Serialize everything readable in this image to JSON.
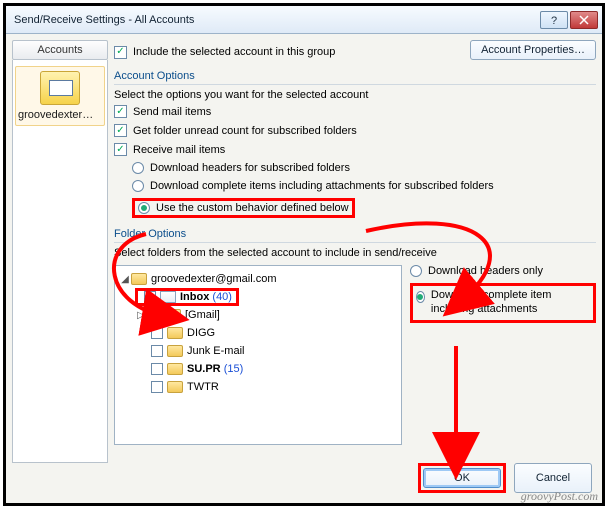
{
  "window": {
    "title": "Send/Receive Settings - All Accounts"
  },
  "left": {
    "header": "Accounts",
    "account_label": "groovedexter@…"
  },
  "top": {
    "include_label": "Include the selected account in this group",
    "account_properties_btn": "Account Properties…"
  },
  "account_options": {
    "heading": "Account Options",
    "intro": "Select the options you want for the selected account",
    "send_mail": "Send mail items",
    "get_unread": "Get folder unread count for subscribed folders",
    "receive_mail": "Receive mail items",
    "r_headers": "Download headers for subscribed folders",
    "r_complete": "Download complete items including attachments for subscribed folders",
    "r_custom": "Use the custom behavior defined below"
  },
  "folder_options": {
    "heading": "Folder Options",
    "intro": "Select folders from the selected account to include in send/receive",
    "right_headers": "Download headers only",
    "right_complete": "Download complete item including attachments",
    "tree": {
      "root": "groovedexter@gmail.com",
      "inbox_label": "Inbox",
      "inbox_count": "(40)",
      "gmail": "[Gmail]",
      "digg": "DIGG",
      "junk": "Junk E-mail",
      "supr_label": "SU.PR",
      "supr_count": "(15)",
      "twtr": "TWTR"
    }
  },
  "buttons": {
    "ok": "OK",
    "cancel": "Cancel"
  },
  "watermark": "groovyPost.com"
}
